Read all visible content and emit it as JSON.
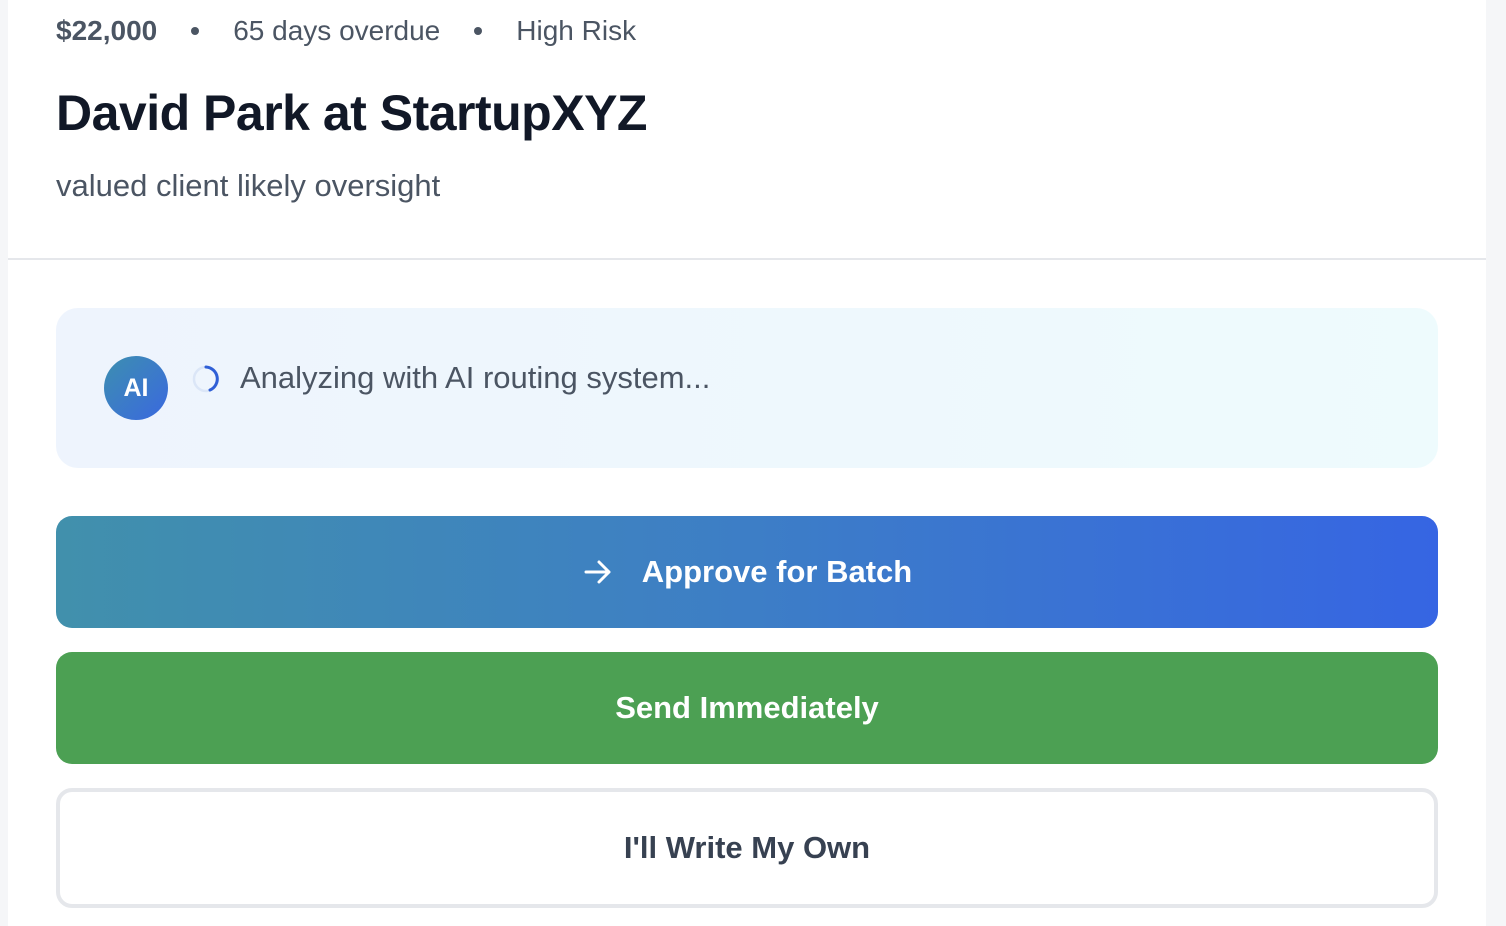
{
  "header": {
    "amount": "$22,000",
    "days_overdue": "65 days overdue",
    "risk": "High Risk",
    "title": "David Park at StartupXYZ",
    "subtitle": "valued client likely oversight"
  },
  "ai_panel": {
    "avatar_label": "AI",
    "status_text": "Analyzing with AI routing system...",
    "spinner_icon": "spinner-icon"
  },
  "actions": {
    "approve_label": "Approve for Batch",
    "approve_icon": "arrow-right-icon",
    "send_label": "Send Immediately",
    "own_label": "I'll Write My Own"
  },
  "colors": {
    "approve_gradient_start": "#4190ac",
    "approve_gradient_end": "#3665e3",
    "send_green": "#4ca053",
    "ai_avatar_start": "#3d8fb0",
    "ai_avatar_end": "#3a68df"
  }
}
